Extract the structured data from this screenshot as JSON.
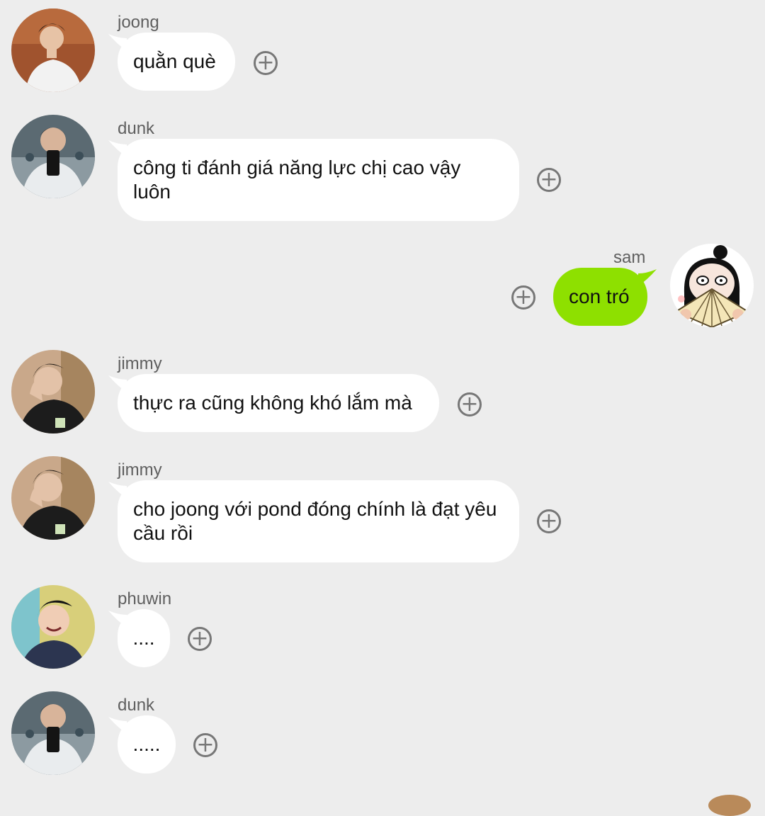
{
  "messages": [
    {
      "sender": "joong",
      "text": "quằn què",
      "add_reaction": "+"
    },
    {
      "sender": "dunk",
      "text": "công ti đánh giá năng lực chị cao vậy luôn",
      "add_reaction": "+"
    },
    {
      "sender": "sam",
      "text": "con tró",
      "add_reaction": "+"
    },
    {
      "sender": "jimmy",
      "text": "thực ra cũng không khó lắm mà",
      "add_reaction": "+"
    },
    {
      "sender": "jimmy",
      "text": "cho joong với pond đóng chính là đạt yêu cầu rồi",
      "add_reaction": "+"
    },
    {
      "sender": "phuwin",
      "text": "....",
      "add_reaction": "+"
    },
    {
      "sender": "dunk",
      "text": ".....",
      "add_reaction": "+"
    }
  ],
  "colors": {
    "background": "#ededed",
    "incoming_bubble": "#ffffff",
    "outgoing_bubble": "#8ee000",
    "sender_name": "#5f5f5f"
  }
}
